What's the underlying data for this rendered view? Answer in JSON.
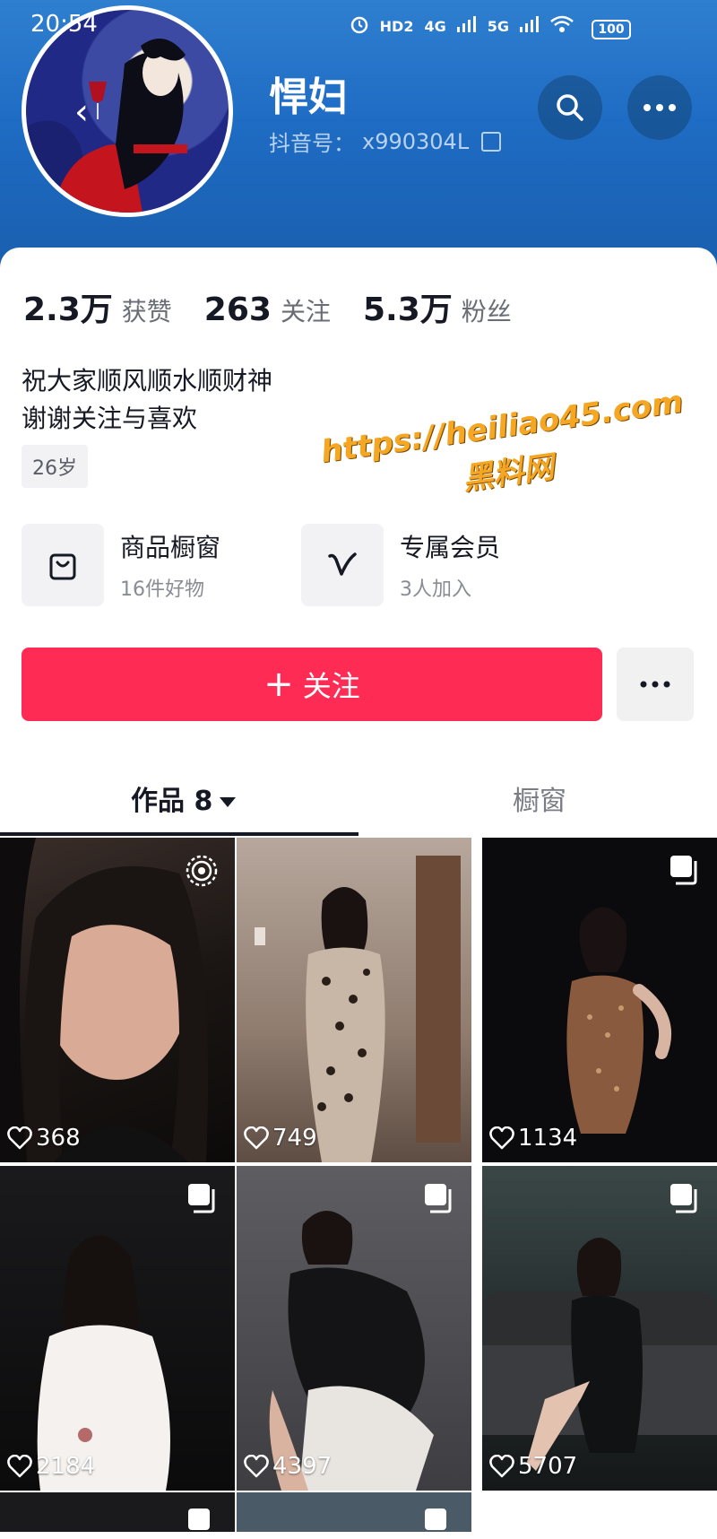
{
  "status_bar": {
    "time": "20:54",
    "indicators": [
      "HD2",
      "4G",
      "5G"
    ],
    "battery": "100"
  },
  "profile": {
    "name": "悍妇",
    "id_label": "抖音号：",
    "id_value": "x990304L"
  },
  "stats": [
    {
      "value": "2.3万",
      "label": "获赞"
    },
    {
      "value": "263",
      "label": "关注"
    },
    {
      "value": "5.3万",
      "label": "粉丝"
    }
  ],
  "bio": {
    "line1": "祝大家顺风顺水顺财神",
    "line2": "谢谢关注与喜欢",
    "age": "26岁"
  },
  "features": {
    "shop": {
      "title": "商品橱窗",
      "subtitle": "16件好物",
      "icon": "shopping-bag-icon"
    },
    "vip": {
      "title": "专属会员",
      "subtitle": "3人加入",
      "icon": "v-member-icon"
    }
  },
  "actions": {
    "follow_label": "关注",
    "more_label": "···"
  },
  "tabs": {
    "works_label": "作品 8",
    "window_label": "橱窗"
  },
  "videos": [
    {
      "likes": "368",
      "badge": "live-icon"
    },
    {
      "likes": "749",
      "badge": ""
    },
    {
      "likes": "1134",
      "badge": "gallery-icon"
    },
    {
      "likes": "2184",
      "badge": "gallery-icon"
    },
    {
      "likes": "4397",
      "badge": "gallery-icon"
    },
    {
      "likes": "5707",
      "badge": "gallery-icon"
    }
  ],
  "watermark": {
    "url": "https://heiliao45.com",
    "name": "黑料网",
    "color": "#f5a623"
  },
  "colors": {
    "header_blue": "#1e6cc4",
    "follow_red": "#fe2c55"
  }
}
